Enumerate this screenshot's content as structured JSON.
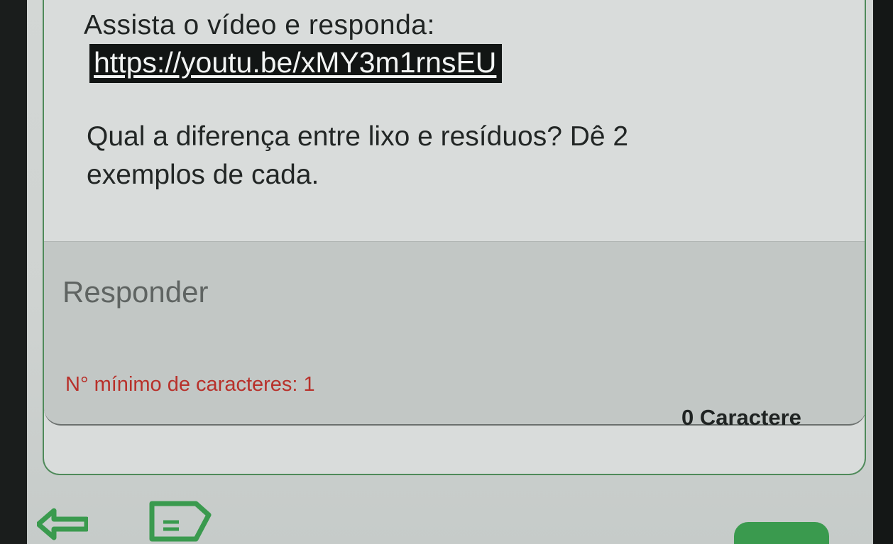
{
  "question": {
    "intro": "Assista o vídeo e responda:",
    "video_link": "https://youtu.be/xMY3m1rnsEU",
    "text": "Qual a diferença entre lixo e resíduos? Dê 2 exemplos de cada."
  },
  "answer": {
    "placeholder": "Responder",
    "value": "",
    "min_chars_label": "N° mínimo de caracteres: 1",
    "char_count_label": "0 Caractere"
  },
  "nav": {
    "back_icon": "back-arrow-icon",
    "doc_icon": "document-icon"
  },
  "colors": {
    "accent": "#3a9a4e",
    "warning_text": "#b8302a",
    "card_border": "#4f8a5a"
  }
}
